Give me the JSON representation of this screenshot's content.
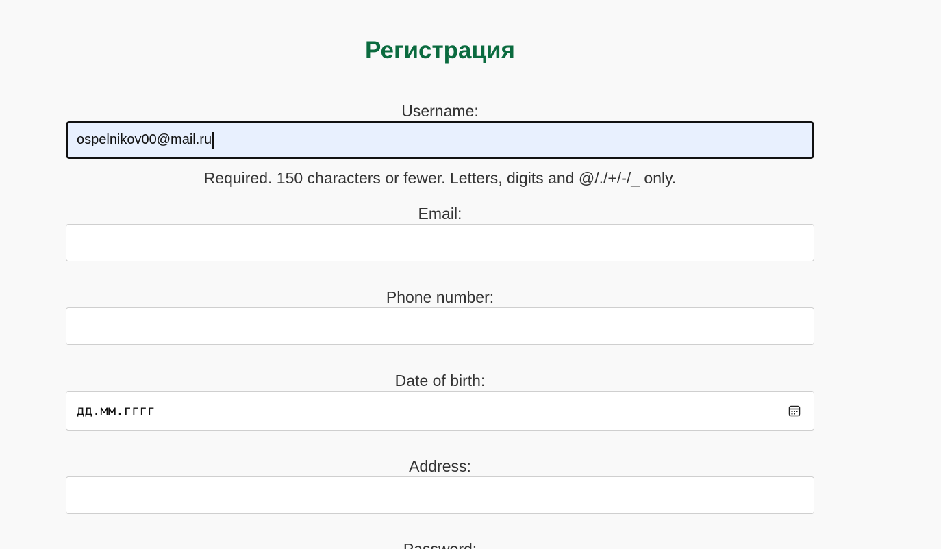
{
  "page": {
    "title": "Регистрация"
  },
  "form": {
    "username": {
      "label": "Username:",
      "value": "ospelnikov00@mail.ru",
      "help": "Required. 150 characters or fewer. Letters, digits and @/./+/-/_ only."
    },
    "email": {
      "label": "Email:",
      "value": ""
    },
    "phone": {
      "label": "Phone number:",
      "value": ""
    },
    "dob": {
      "label": "Date of birth:",
      "placeholder": "дд.мм.гггг"
    },
    "address": {
      "label": "Address:",
      "value": ""
    },
    "password": {
      "label": "Password:"
    }
  },
  "colors": {
    "title": "#0b6b3f",
    "background": "#f9f9f9",
    "focused_field": "#e8f0fe"
  },
  "icons": {
    "date_picker": "calendar-icon"
  }
}
